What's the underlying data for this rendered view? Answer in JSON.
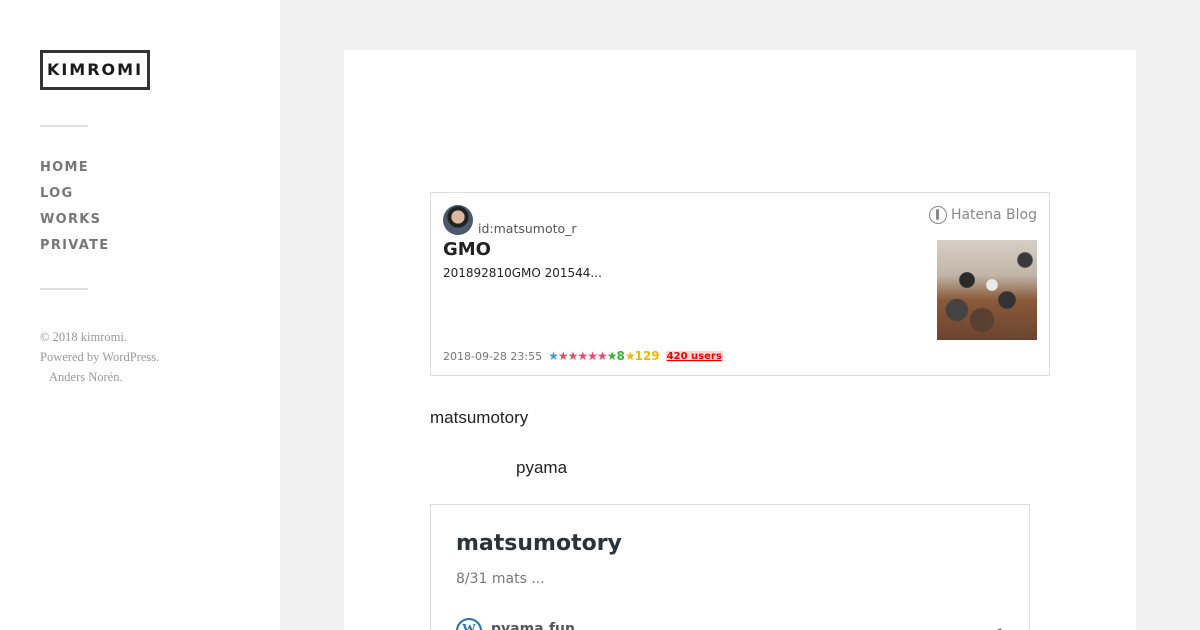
{
  "sidebar": {
    "site_title": "KIMROMI",
    "nav": [
      "HOME",
      "LOG",
      "WORKS",
      "PRIVATE"
    ],
    "credits": {
      "copyright": "© 2018 kimromi.",
      "powered": "Powered by WordPress.",
      "author": "Anders Norén."
    }
  },
  "embed_card": {
    "user_id": "id:matsumoto_r",
    "service": "Hatena Blog",
    "title": "GMO",
    "description": "201892810GMO 201544...",
    "date": "2018-09-28 23:55",
    "star_green_count": "8",
    "star_yellow_count": "129",
    "bookmark_users": "420 users"
  },
  "content": {
    "para1": "matsumotory",
    "para2": "pyama"
  },
  "wp_embed": {
    "title": "matsumotory",
    "excerpt": "8/31 mats ...",
    "site": "pyama.fun"
  },
  "icons": {
    "avatar": "user-avatar",
    "hatena": "hatena-logo-icon",
    "wp": "wordpress-icon",
    "share": "share-icon"
  }
}
